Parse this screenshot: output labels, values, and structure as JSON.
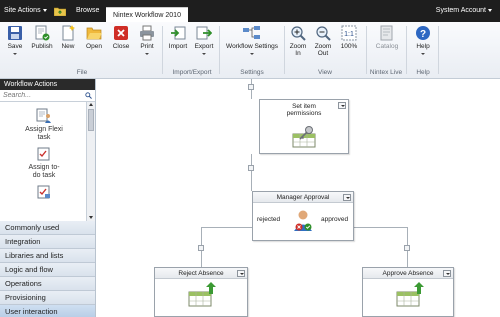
{
  "topbar": {
    "site_actions": "Site Actions",
    "browse_tab": "Browse",
    "nintex_tab": "Nintex Workflow 2010",
    "user": "System Account",
    "folder_icon": "folder-up-icon"
  },
  "ribbon": {
    "buttons": {
      "save": "Save",
      "publish": "Publish",
      "new": "New",
      "open": "Open",
      "close": "Close",
      "print": "Print",
      "import": "Import",
      "export": "Export",
      "workflow_settings": "Workflow Settings",
      "zoom_in_1": "Zoom",
      "zoom_in_2": "In",
      "zoom_out_1": "Zoom",
      "zoom_out_2": "Out",
      "zoom_100": "100%",
      "catalog": "Catalog",
      "help": "Help"
    },
    "groups": {
      "file": "File",
      "import_export": "Import/Export",
      "settings": "Settings",
      "view": "View",
      "nintex_live": "Nintex Live",
      "help": "Help"
    }
  },
  "left_panel": {
    "header": "Workflow Actions",
    "search_placeholder": "Search...",
    "actions": [
      {
        "line1": "Assign Flexi",
        "line2": "task"
      },
      {
        "line1": "Assign to-",
        "line2": "do task"
      }
    ],
    "categories": [
      "Commonly used",
      "Integration",
      "Libraries and lists",
      "Logic and flow",
      "Operations",
      "Provisioning",
      "User interaction"
    ],
    "selected_category": "User interaction"
  },
  "canvas": {
    "nodes": {
      "set_permissions": {
        "line1": "Set item",
        "line2": "permissions"
      },
      "manager_approval": {
        "title": "Manager Approval",
        "left": "rejected",
        "right": "approved"
      },
      "reject_absence": {
        "title": "Reject Absence"
      },
      "approve_absence": {
        "title": "Approve Absence"
      }
    }
  },
  "colors": {
    "topbar_bg": "#1e1e1e",
    "category_selected": "#b7cde6",
    "connector": "#a8b0b8"
  }
}
